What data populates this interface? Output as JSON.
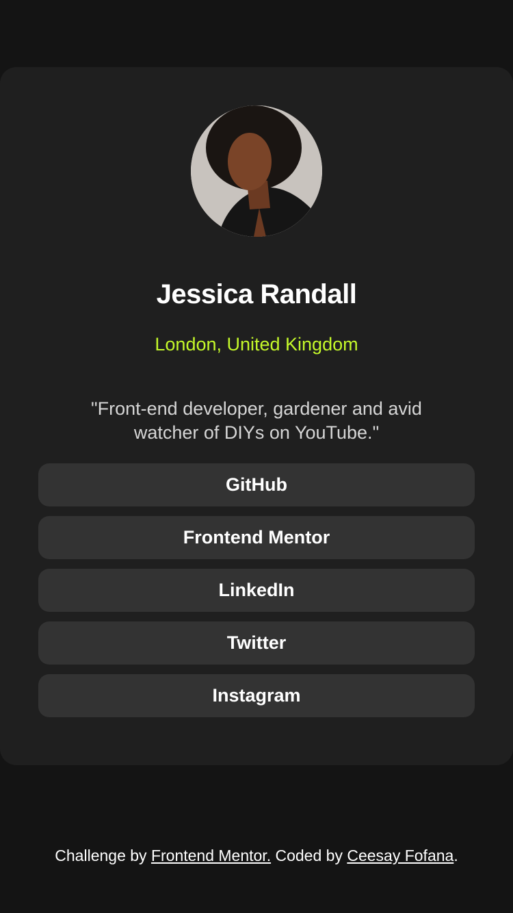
{
  "profile": {
    "avatar_alt": "profile photo",
    "name": "Jessica Randall",
    "location": "London, United Kingdom",
    "bio": "\"Front-end developer, gardener and avid watcher of DIYs on YouTube.\""
  },
  "links": [
    {
      "label": "GitHub"
    },
    {
      "label": "Frontend Mentor"
    },
    {
      "label": "LinkedIn"
    },
    {
      "label": "Twitter"
    },
    {
      "label": "Instagram"
    }
  ],
  "footer": {
    "prefix": "Challenge by ",
    "challenge_link": "Frontend Mentor.",
    "middle": " Coded by ",
    "author_link": "Ceesay Fofana",
    "suffix": "."
  },
  "colors": {
    "background": "#141414",
    "card": "#1f1f1f",
    "button": "#333333",
    "accent": "#c4f82a",
    "text": "#ffffff"
  }
}
